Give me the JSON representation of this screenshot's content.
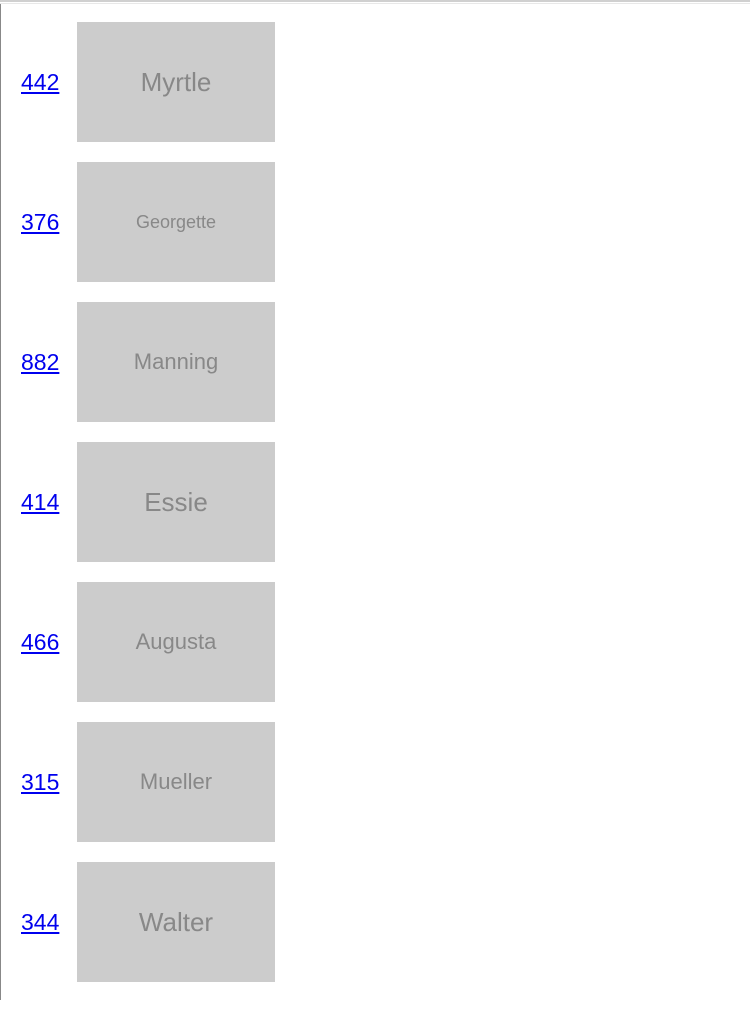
{
  "rows": [
    {
      "id": "442",
      "name": "Myrtle",
      "size": "larger"
    },
    {
      "id": "376",
      "name": "Georgette",
      "size": "smaller"
    },
    {
      "id": "882",
      "name": "Manning",
      "size": "normal"
    },
    {
      "id": "414",
      "name": "Essie",
      "size": "larger"
    },
    {
      "id": "466",
      "name": "Augusta",
      "size": "normal"
    },
    {
      "id": "315",
      "name": "Mueller",
      "size": "normal"
    },
    {
      "id": "344",
      "name": "Walter",
      "size": "larger"
    }
  ]
}
